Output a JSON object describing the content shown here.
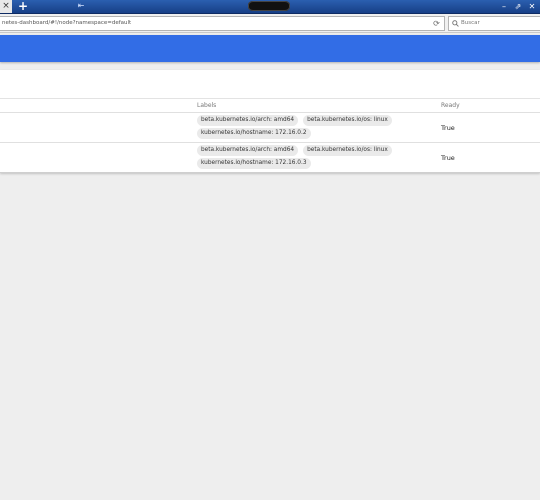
{
  "browser": {
    "tab_close_glyph": "×",
    "new_tab_glyph": "+",
    "titlebar_arrow_glyph": "⇤",
    "window_controls": [
      "–",
      "⇗",
      "✕"
    ],
    "url": "netes-dashboard/#!/node?namespace=default",
    "reload_glyph": "⟳",
    "search_icon_glyph": "🔍",
    "search_placeholder": "Buscar"
  },
  "colors": {
    "header_blue": "#326de6",
    "titlebar_blue": "#1f4a99"
  },
  "table": {
    "headers": {
      "labels": "Labels",
      "ready": "Ready"
    },
    "rows": [
      {
        "labels": [
          "beta.kubernetes.io/arch: amd64",
          "beta.kubernetes.io/os: linux",
          "kubernetes.io/hostname: 172.16.0.2"
        ],
        "ready": "True"
      },
      {
        "labels": [
          "beta.kubernetes.io/arch: amd64",
          "beta.kubernetes.io/os: linux",
          "kubernetes.io/hostname: 172.16.0.3"
        ],
        "ready": "True"
      }
    ]
  }
}
